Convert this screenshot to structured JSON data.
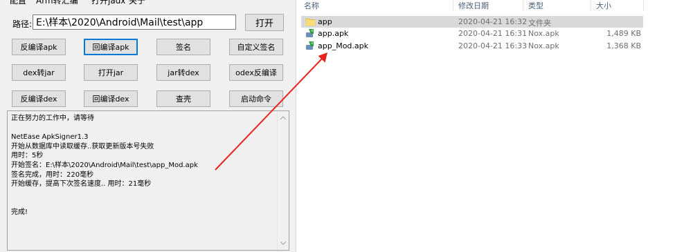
{
  "menu": [
    "配置",
    "Arm转汇编",
    "打开jadx",
    "关于"
  ],
  "path": {
    "label": "路径:",
    "value": "E:\\样本\\2020\\Android\\Mail\\test\\app",
    "open_button": "打开"
  },
  "buttons": [
    "反编译apk",
    "回编译apk",
    "签名",
    "自定义签名",
    "dex转jar",
    "打开jar",
    "jar转dex",
    "odex反编译",
    "反编译dex",
    "回编译dex",
    "查壳",
    "启动命令"
  ],
  "log": [
    "正在努力的工作中，请等待",
    "",
    "NetEase ApkSigner1.3",
    "开始从数据库中读取缓存..获取更新版本号失败",
    " 用时：5秒",
    "开始签名：E:\\样本\\2020\\Android\\Mail\\test\\app_Mod.apk",
    "签名完成，用时：220毫秒",
    "开始缓存，提高下次签名速度.. 用时：21毫秒",
    "",
    "",
    "完成!"
  ],
  "explorer": {
    "headers": {
      "name": "名称",
      "date": "修改日期",
      "type": "类型",
      "size": "大小"
    },
    "files": [
      {
        "name": "app",
        "date": "2020-04-21 16:32",
        "type": "文件夹",
        "size": "",
        "icon": "folder-icon",
        "selected": true
      },
      {
        "name": "app.apk",
        "date": "2020-04-21 16:31",
        "type": "Nox.apk",
        "size": "1,489 KB",
        "icon": "apk-icon",
        "selected": false
      },
      {
        "name": "app_Mod.apk",
        "date": "2020-04-21 16:33",
        "type": "Nox.apk",
        "size": "1,368 KB",
        "icon": "apk-icon",
        "selected": false
      }
    ]
  },
  "colors": {
    "arrow": "#e8231e",
    "folder": "#f6d66a",
    "selection": "#d9d9d9",
    "focus_border": "#0078d7"
  }
}
